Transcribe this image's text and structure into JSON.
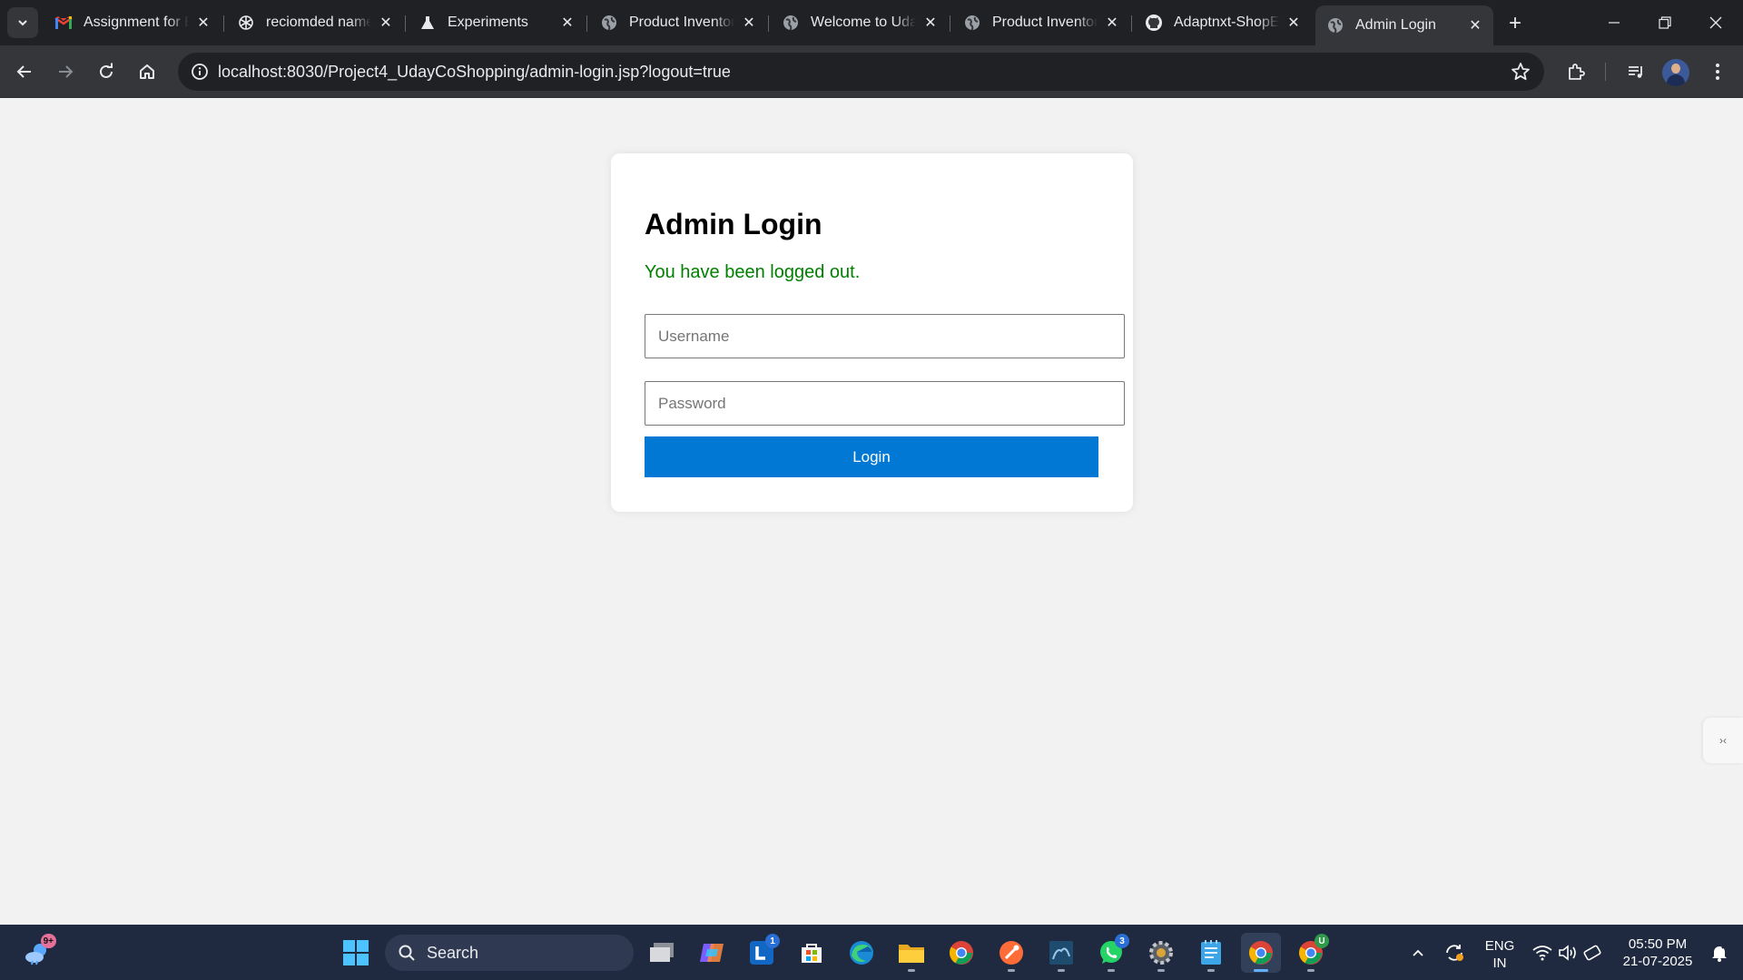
{
  "browser": {
    "tabs": [
      {
        "title": "Assignment for E",
        "icon": "gmail-icon",
        "active": false
      },
      {
        "title": "reciomded name",
        "icon": "openai-icon",
        "active": false
      },
      {
        "title": "Experiments",
        "icon": "flask-icon",
        "active": false
      },
      {
        "title": "Product Inventor",
        "icon": "globe-icon",
        "active": false
      },
      {
        "title": "Welcome to Uda",
        "icon": "globe-icon",
        "active": false
      },
      {
        "title": "Product Inventor",
        "icon": "globe-icon",
        "active": false
      },
      {
        "title": "Adaptnxt-ShopE",
        "icon": "github-icon",
        "active": false
      },
      {
        "title": "Admin Login",
        "icon": "globe-icon",
        "active": true
      }
    ],
    "address": {
      "host": "localhost",
      "rest": ":8030/Project4_UdayCoShopping/admin-login.jsp?logout=true"
    }
  },
  "page": {
    "heading": "Admin Login",
    "message": "You have been logged out.",
    "username_placeholder": "Username",
    "password_placeholder": "Password",
    "login_label": "Login"
  },
  "taskbar": {
    "widgets_badge": "9+",
    "search_label": "Search",
    "apps": [
      {
        "name": "task-view",
        "badge": ""
      },
      {
        "name": "copilot",
        "badge": ""
      },
      {
        "name": "linkedin",
        "badge": "1"
      },
      {
        "name": "microsoft-store",
        "badge": ""
      },
      {
        "name": "edge",
        "badge": ""
      },
      {
        "name": "file-explorer",
        "badge": ""
      },
      {
        "name": "chrome",
        "badge": ""
      },
      {
        "name": "postman",
        "badge": ""
      },
      {
        "name": "mysql-workbench",
        "badge": ""
      },
      {
        "name": "whatsapp",
        "badge": "3"
      },
      {
        "name": "settings",
        "badge": ""
      },
      {
        "name": "notepad",
        "badge": ""
      },
      {
        "name": "chrome-profile-active",
        "badge": ""
      },
      {
        "name": "chrome-profile-u",
        "badge": "U"
      }
    ],
    "language": {
      "line1": "ENG",
      "line2": "IN"
    },
    "clock": {
      "time": "05:50 PM",
      "date": "21-07-2025"
    }
  },
  "colors": {
    "accent": "#0078d4",
    "success_text": "#008000",
    "page_bg": "#f2f2f2",
    "chrome_dark": "#202124",
    "taskbar_bg": "#1f2a40"
  }
}
